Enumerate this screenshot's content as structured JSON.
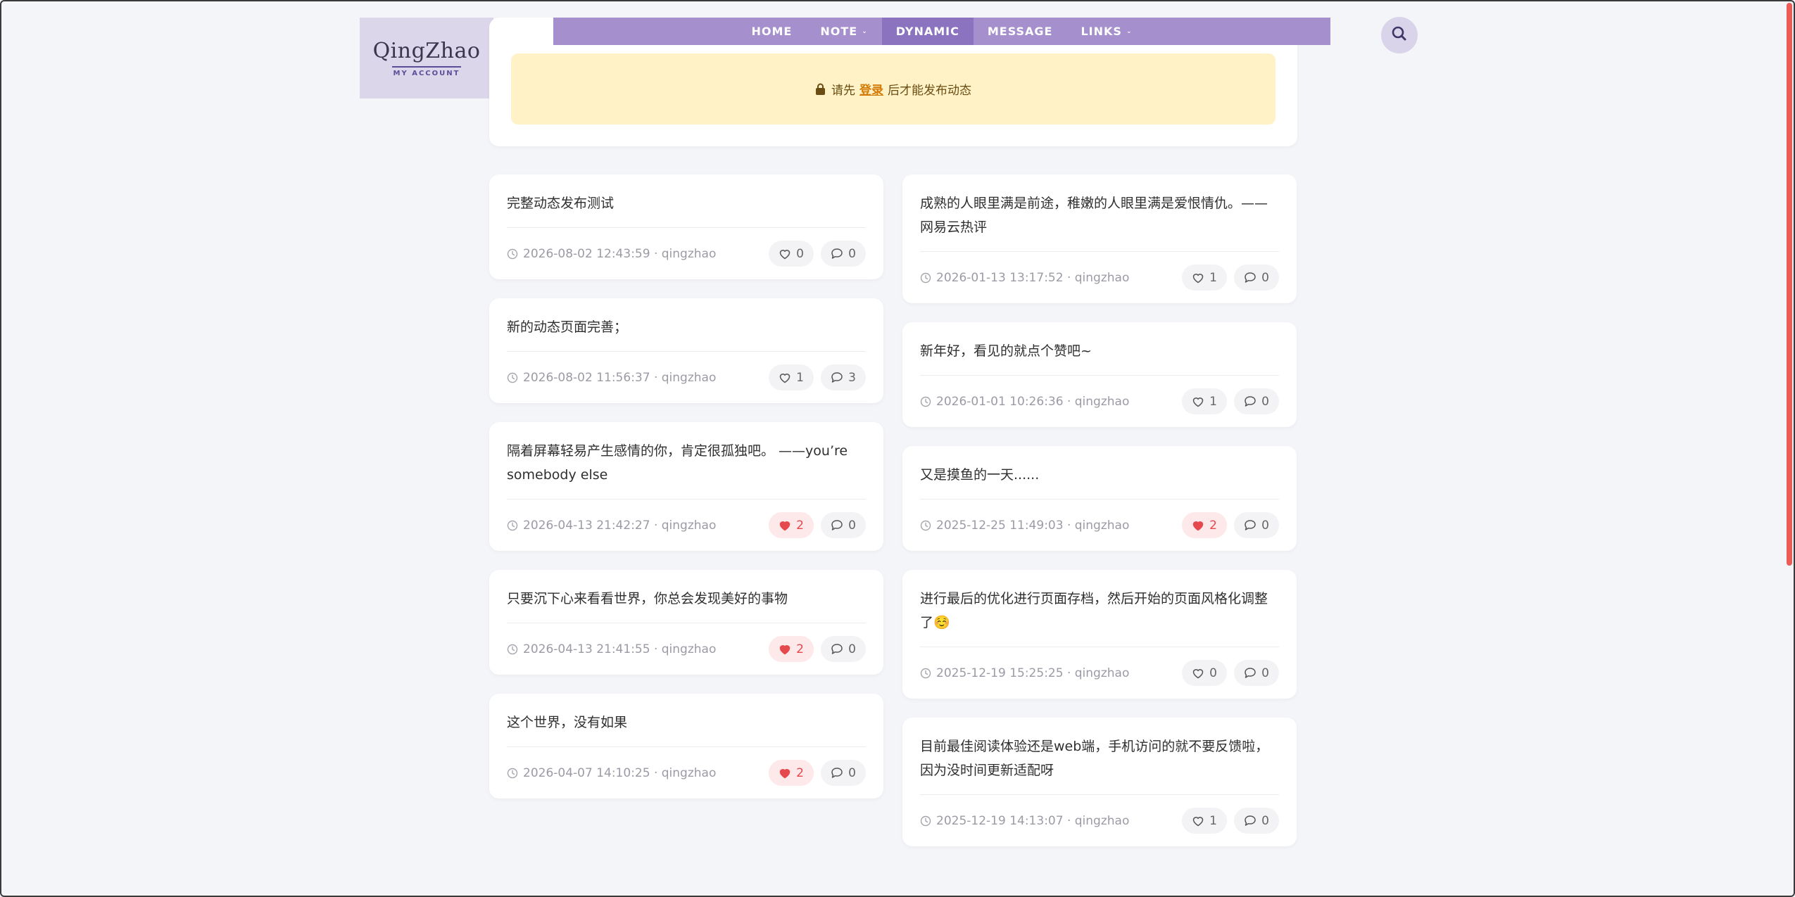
{
  "logo": {
    "name": "QingZhao",
    "subtitle": "MY ACCOUNT"
  },
  "nav": {
    "items": [
      {
        "label": "HOME",
        "has_caret": false,
        "active": false
      },
      {
        "label": "NOTE",
        "has_caret": true,
        "active": false
      },
      {
        "label": "DYNAMIC",
        "has_caret": false,
        "active": true
      },
      {
        "label": "MESSAGE",
        "has_caret": false,
        "active": false
      },
      {
        "label": "LINKS",
        "has_caret": true,
        "active": false
      }
    ]
  },
  "search": {
    "icon": "search-icon"
  },
  "notice": {
    "before": "请先",
    "link": "登录",
    "after": "后才能发布动态",
    "icon": "lock-icon"
  },
  "colors": {
    "nav": "#a58fcd",
    "nav_active": "#8b73c0",
    "logo_bg": "#dcd6ea",
    "notice_bg": "#fff2c7",
    "like_active": "#e5484d",
    "scrollbar": "#ea5c55"
  },
  "posts_left": [
    {
      "text": "完整动态发布测试",
      "time": "2026-08-02 12:43:59 · qingzhao",
      "likes": "0",
      "comments": "0",
      "liked": false
    },
    {
      "text": "新的动态页面完善；",
      "time": "2026-08-02 11:56:37 · qingzhao",
      "likes": "1",
      "comments": "3",
      "liked": false
    },
    {
      "text": "隔着屏幕轻易产生感情的你，肯定很孤独吧。 ——you’re somebody else",
      "time": "2026-04-13 21:42:27 · qingzhao",
      "likes": "2",
      "comments": "0",
      "liked": true
    },
    {
      "text": "只要沉下心来看看世界，你总会发现美好的事物",
      "time": "2026-04-13 21:41:55 · qingzhao",
      "likes": "2",
      "comments": "0",
      "liked": true
    },
    {
      "text": "这个世界，没有如果",
      "time": "2026-04-07 14:10:25 · qingzhao",
      "likes": "2",
      "comments": "0",
      "liked": true
    }
  ],
  "posts_right": [
    {
      "text": "成熟的人眼里满是前途，稚嫩的人眼里满是爱恨情仇。——网易云热评",
      "time": "2026-01-13 13:17:52 · qingzhao",
      "likes": "1",
      "comments": "0",
      "liked": false
    },
    {
      "text": "新年好，看见的就点个赞吧~",
      "time": "2026-01-01 10:26:36 · qingzhao",
      "likes": "1",
      "comments": "0",
      "liked": false
    },
    {
      "text": "又是摸鱼的一天......",
      "time": "2025-12-25 11:49:03 · qingzhao",
      "likes": "2",
      "comments": "0",
      "liked": true
    },
    {
      "text": "进行最后的优化进行页面存档，然后开始的页面风格化调整了☺️",
      "time": "2025-12-19 15:25:25 · qingzhao",
      "likes": "0",
      "comments": "0",
      "liked": false
    },
    {
      "text": "目前最佳阅读体验还是web端，手机访问的就不要反馈啦，因为没时间更新适配呀",
      "time": "2025-12-19 14:13:07 · qingzhao",
      "likes": "1",
      "comments": "0",
      "liked": false
    }
  ]
}
